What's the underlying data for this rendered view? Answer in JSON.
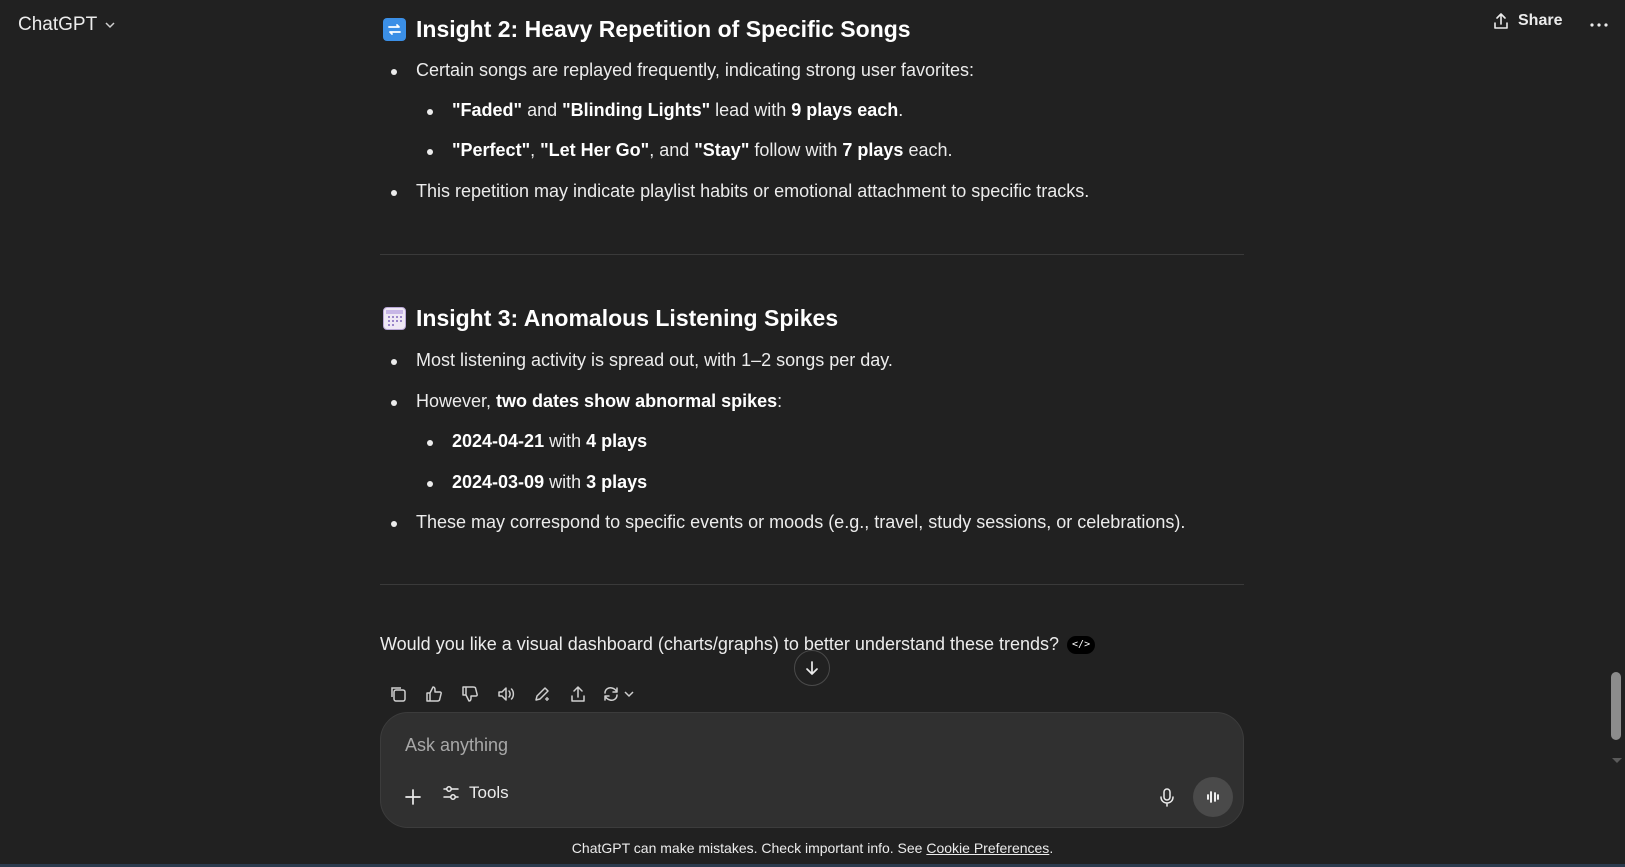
{
  "header": {
    "model_label": "ChatGPT",
    "share_label": "Share"
  },
  "insight2": {
    "title": "Insight 2: Heavy Repetition of Specific Songs",
    "icon": "repeat-icon",
    "intro": "Certain songs are replayed frequently, indicating strong user favorites:",
    "sub1": {
      "song1": "\"Faded\"",
      "and": " and ",
      "song2": "\"Blinding Lights\"",
      "mid": " lead with ",
      "count": "9 plays each",
      "end": "."
    },
    "sub2": {
      "song1": "\"Perfect\"",
      "sep1": ", ",
      "song2": "\"Let Her Go\"",
      "sep2": ", and ",
      "song3": "\"Stay\"",
      "mid": " follow with ",
      "count": "7 plays",
      "end": " each."
    },
    "closing": "This repetition may indicate playlist habits or emotional attachment to specific tracks."
  },
  "insight3": {
    "title": "Insight 3: Anomalous Listening Spikes",
    "icon": "calendar-icon",
    "b1": "Most listening activity is spread out, with 1–2 songs per day.",
    "b2": {
      "pre": "However, ",
      "bold": "two dates show abnormal spikes",
      "post": ":"
    },
    "spike1": {
      "date": "2024-04-21",
      "mid": " with ",
      "count": "4 plays"
    },
    "spike2": {
      "date": "2024-03-09",
      "mid": " with ",
      "count": "3 plays"
    },
    "b3": "These may correspond to specific events or moods (e.g., travel, study sessions, or celebrations)."
  },
  "question": "Would you like a visual dashboard (charts/graphs) to better understand these trends?",
  "code_badge": "</>",
  "composer": {
    "placeholder": "Ask anything",
    "tools_label": "Tools"
  },
  "footer": {
    "text": "ChatGPT can make mistakes. Check important info. See ",
    "link": "Cookie Preferences",
    "end": "."
  },
  "colors": {
    "background": "#212121",
    "composer": "#303030",
    "text": "#ececec"
  }
}
